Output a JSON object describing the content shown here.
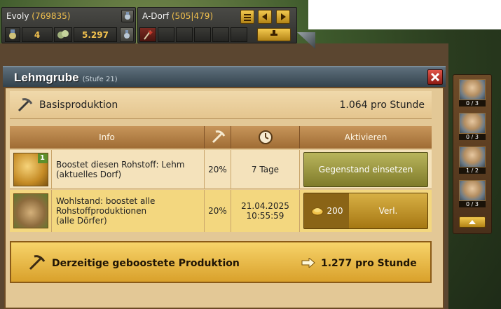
{
  "player": {
    "name": "Evoly",
    "points": "(769835)"
  },
  "village": {
    "name": "A-Dorf",
    "coords": "(505|479)"
  },
  "resources": {
    "premium": "4",
    "silver": "5.297"
  },
  "dialog": {
    "title": "Lehmgrube",
    "level": "(Stufe 21)",
    "close_icon": "close-icon",
    "base_label": "Basisproduktion",
    "base_value": "1.064 pro Stunde",
    "headers": {
      "info": "Info",
      "activate": "Aktivieren"
    },
    "rows": [
      {
        "level_badge": "1",
        "desc_line1": "Boostet diesen Rohstoff: Lehm",
        "desc_line2": "(aktuelles Dorf)",
        "desc_line3": "",
        "percent": "20%",
        "duration": "7 Tage",
        "duration2": "",
        "action_label": "Gegenstand einsetzen"
      },
      {
        "level_badge": "",
        "desc_line1": "Wohlstand: boostet alle",
        "desc_line2": "Rohstoffproduktionen",
        "desc_line3": "(alle Dörfer)",
        "percent": "20%",
        "duration": "21.04.2025",
        "duration2": "10:55:59",
        "cost": "200",
        "action_label": "Verl."
      }
    ],
    "boost_label": "Derzeitige geboostete Produktion",
    "boost_value": "1.277 pro Stunde"
  },
  "sidebar": {
    "slots": [
      {
        "count": "0 / 3"
      },
      {
        "count": "0 / 3"
      },
      {
        "count": "1 / 2"
      },
      {
        "count": "0 / 3"
      }
    ]
  },
  "colors": {
    "accent": "#f2c14e",
    "title_bar": "#33424c",
    "panel": "#e3c896"
  }
}
